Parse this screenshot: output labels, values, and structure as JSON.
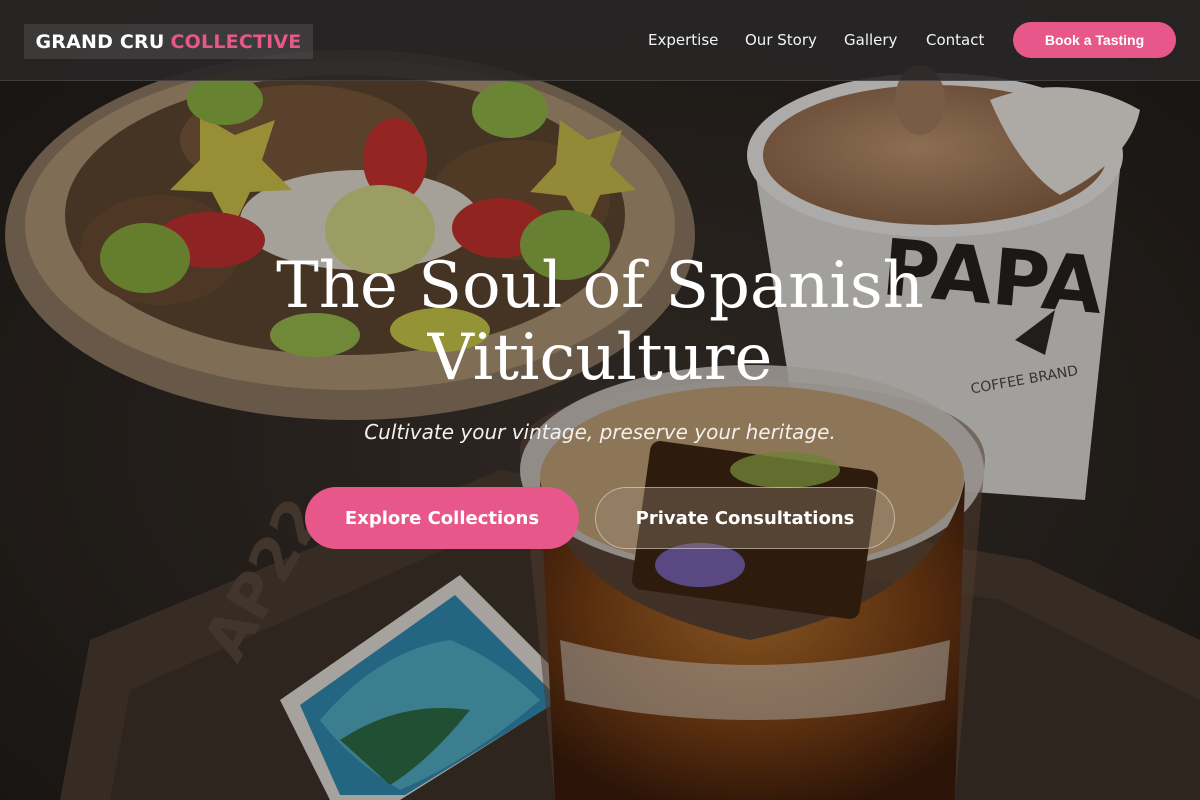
{
  "brand": {
    "part1": "GRAND CRU",
    "part2": "COLLECTIVE"
  },
  "nav": {
    "links": [
      "Expertise",
      "Our Story",
      "Gallery",
      "Contact"
    ],
    "cta_label": "Book a Tasting"
  },
  "hero": {
    "title_line1": "The Soul of Spanish",
    "title_line2": "Viticulture",
    "subtitle": "Cultivate your vintage, preserve your heritage.",
    "primary_button": "Explore Collections",
    "secondary_button": "Private Consultations"
  },
  "colors": {
    "accent": "#e8578a",
    "nav_bg": "#282626"
  }
}
